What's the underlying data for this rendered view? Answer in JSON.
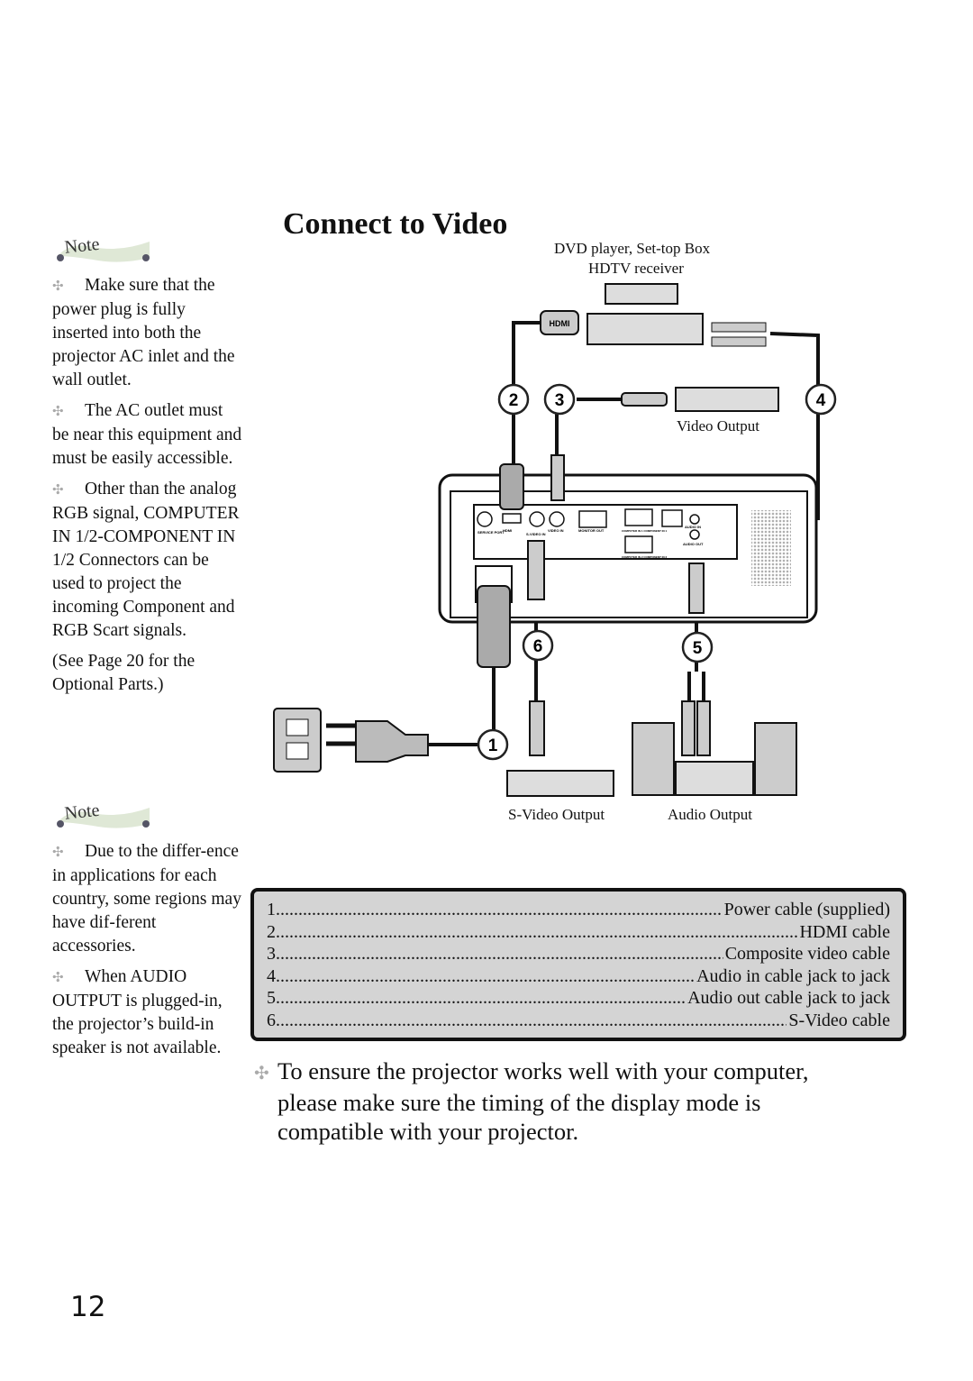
{
  "title": "Connect to Video",
  "sidebar": {
    "note_label": "Note",
    "notes_top": [
      "Make sure that the power plug is fully inserted into both the projector AC inlet and the wall outlet.",
      "The AC outlet must be near this equipment and must be easily accessible.",
      "Other than the analog RGB signal, COMPUTER IN 1/2-COMPONENT IN 1/2 Connectors can be used to project the incoming Component and RGB Scart signals."
    ],
    "see_page": "(See Page 20 for the Optional Parts.)",
    "notes_bottom": [
      "Due to the differ-ence in applications for each country, some regions may have dif-ferent accessories.",
      "When AUDIO OUTPUT is plugged-in, the projector’s build-in speaker is not available."
    ]
  },
  "diagram": {
    "dvd_label_1": "DVD player, Set-top Box",
    "dvd_label_2": "HDTV receiver",
    "video_output": "Video Output",
    "svideo_output": "S-Video Output",
    "audio_output": "Audio Output",
    "hdmi_plug": "HDMI",
    "callouts": [
      "1",
      "2",
      "3",
      "4",
      "5",
      "6"
    ],
    "ports": {
      "service": "SERVICE PORT",
      "hdmi": "HDMI",
      "svideo": "S-VIDEO IN",
      "video": "VIDEO IN",
      "monitor": "MONITOR OUT",
      "comp1": "COMPUTER IN 1 COMPONENT IN 1",
      "comp2": "COMPUTER IN 2 COMPONENT IN 2",
      "audio_in": "AUDIO IN",
      "audio_out": "AUDIO OUT"
    }
  },
  "cables": [
    {
      "num": "1",
      "desc": "Power cable (supplied)"
    },
    {
      "num": "2",
      "desc": "HDMI cable"
    },
    {
      "num": "3",
      "desc": "Composite video cable"
    },
    {
      "num": "4",
      "desc": "Audio in cable jack to jack"
    },
    {
      "num": "5",
      "desc": "Audio out cable jack to jack"
    },
    {
      "num": "6",
      "desc": "S-Video cable"
    }
  ],
  "footer": {
    "line1": "To ensure the projector works well with your computer,",
    "line2": "please make sure the timing of the display mode is",
    "line3": "compatible with your projector."
  },
  "page_number": "12",
  "icons": {
    "bullet": "four-diamond-bullet",
    "note": "scroll-banner"
  }
}
